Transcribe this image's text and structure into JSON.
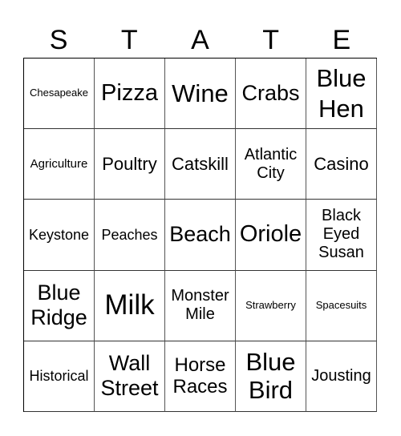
{
  "header": [
    "S",
    "T",
    "A",
    "T",
    "E"
  ],
  "rows": [
    [
      "Chesapeake",
      "Pizza",
      "Wine",
      "Crabs",
      "Blue\nHen"
    ],
    [
      "Agriculture",
      "Poultry",
      "Catskill",
      "Atlantic\nCity",
      "Casino"
    ],
    [
      "Keystone",
      "Peaches",
      "Beach",
      "Oriole",
      "Black\nEyed\nSusan"
    ],
    [
      "Blue\nRidge",
      "Milk",
      "Monster\nMile",
      "Strawberry",
      "Spacesuits"
    ],
    [
      "Historical",
      "Wall\nStreet",
      "Horse\nRaces",
      "Blue\nBird",
      "Jousting"
    ]
  ]
}
